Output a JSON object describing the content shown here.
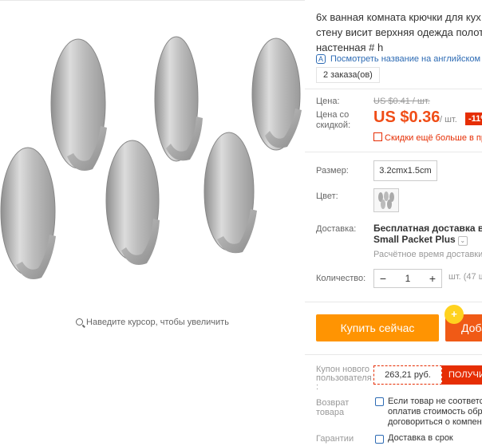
{
  "product": {
    "title_lines": [
      "6х ванная комната крючки для кух",
      "стену висит верхняя одежда полот",
      "настенная # h"
    ],
    "translate_link": "Посмотреть название на английском",
    "orders": "2 заказа(ов)"
  },
  "gallery": {
    "zoom_hint": "Наведите курсор, чтобы увеличить"
  },
  "pricing": {
    "price_label": "Цена:",
    "old_price": "US $0.41 / шт.",
    "discount_label_lines": [
      "Цена со",
      "скидкой:"
    ],
    "price": "US $0.36",
    "per_unit": "/ шт.",
    "discount_badge": "-11%",
    "promo": "Скидки ещё больше в пр"
  },
  "options": {
    "size_label": "Размер:",
    "size_value": "3.2cmx1.5cm",
    "color_label": "Цвет:"
  },
  "shipping": {
    "label": "Доставка:",
    "line1": "Бесплатная доставка в Ru",
    "line2": "Small Packet Plus",
    "estimate": "Расчётное время доставки:"
  },
  "quantity": {
    "label": "Количество:",
    "value": "1",
    "minus": "−",
    "plus": "+",
    "available": "шт. (47 ш"
  },
  "actions": {
    "buy_now": "Купить сейчас",
    "add_to_cart": "Доба"
  },
  "coupon": {
    "label_lines": [
      "Купон нового",
      "пользователя",
      ":"
    ],
    "value": "263,21 руб.",
    "button": "ПОЛУЧИ"
  },
  "returns": {
    "label_lines": [
      "Возврат",
      "товара"
    ],
    "text_lines": [
      "Если товар не соответст",
      "оплатив стоимость обра",
      "договориться о компенс"
    ]
  },
  "guarantee": {
    "label": "Гарантии",
    "text": "Доставка в срок"
  },
  "colors": {
    "price_red": "#f04d17",
    "buy_orange": "#ff9402",
    "cart_orange": "#f05a16",
    "link_blue": "#2d6bb4"
  }
}
